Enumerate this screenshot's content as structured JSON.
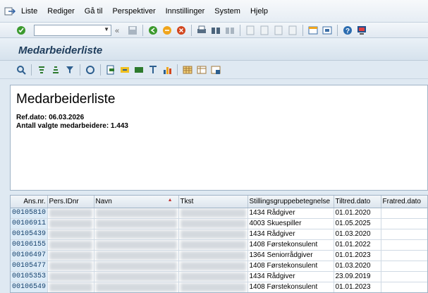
{
  "menu": {
    "items": [
      {
        "label": "Liste"
      },
      {
        "label": "Rediger"
      },
      {
        "label": "Gå til"
      },
      {
        "label": "Perspektiver"
      },
      {
        "label": "Innstillinger"
      },
      {
        "label": "System"
      },
      {
        "label": "Hjelp"
      }
    ]
  },
  "title": "Medarbeiderliste",
  "header": {
    "heading": "Medarbeiderliste",
    "ref_line": "Ref.dato: 06.03.2026",
    "count_line": "Antall valgte medarbeidere: 1.443"
  },
  "grid": {
    "columns": [
      "Ans.nr.",
      "Pers.IDnr",
      "Navn",
      "Tkst",
      "Stillingsgruppebetegnelse",
      "Tiltred.dato",
      "Fratred.dato"
    ],
    "rows": [
      {
        "ansnr": "00105810",
        "stilling": "1434 Rådgiver",
        "tiltred": "01.01.2020",
        "fratred": ""
      },
      {
        "ansnr": "00106911",
        "stilling": "4003 Skuespiller",
        "tiltred": "01.05.2025",
        "fratred": ""
      },
      {
        "ansnr": "00105439",
        "stilling": "1434 Rådgiver",
        "tiltred": "01.03.2020",
        "fratred": ""
      },
      {
        "ansnr": "00106155",
        "stilling": "1408 Førstekonsulent",
        "tiltred": "01.01.2022",
        "fratred": ""
      },
      {
        "ansnr": "00106497",
        "stilling": "1364 Seniorrådgiver",
        "tiltred": "01.01.2023",
        "fratred": ""
      },
      {
        "ansnr": "00105477",
        "stilling": "1408 Førstekonsulent",
        "tiltred": "01.03.2020",
        "fratred": ""
      },
      {
        "ansnr": "00105353",
        "stilling": "1434 Rådgiver",
        "tiltred": "23.09.2019",
        "fratred": ""
      },
      {
        "ansnr": "00106549",
        "stilling": "1408 Førstekonsulent",
        "tiltred": "01.01.2023",
        "fratred": ""
      }
    ]
  },
  "colors": {
    "key_column_bg": "#dcebf7",
    "title_text": "#1f3d5c"
  }
}
